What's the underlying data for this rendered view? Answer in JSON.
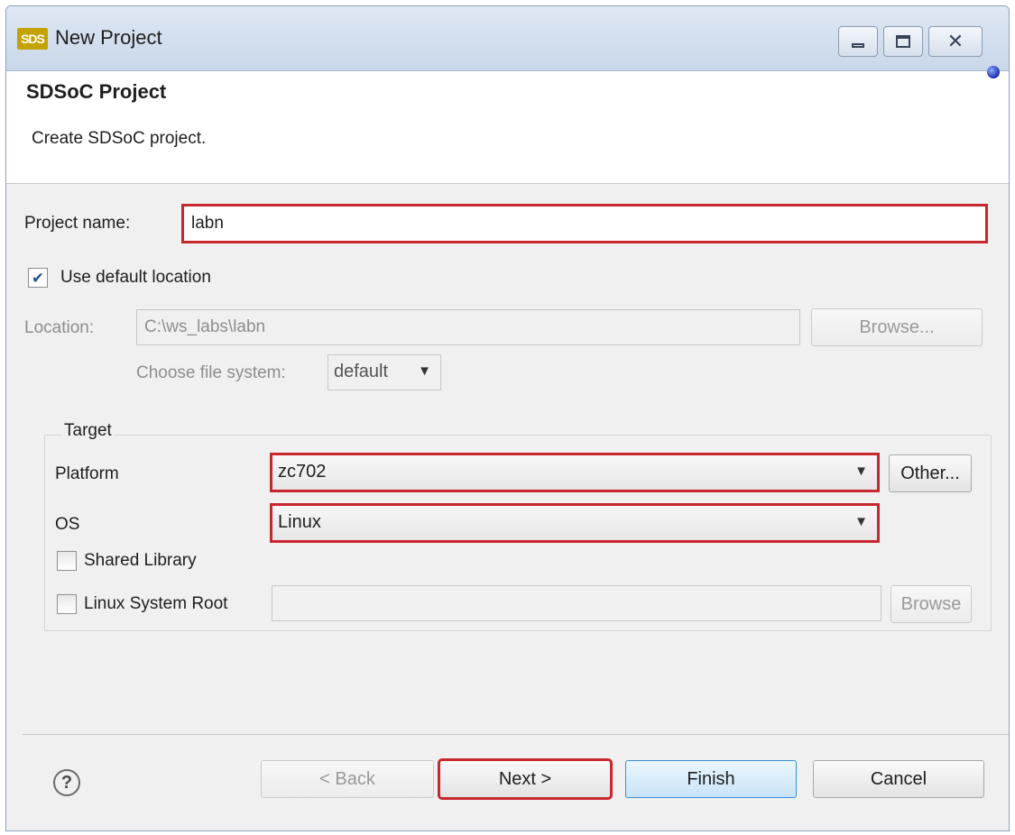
{
  "window": {
    "icon_text": "SDS",
    "title": "New Project"
  },
  "banner": {
    "title": "SDSoC Project",
    "description": "Create SDSoC project."
  },
  "form": {
    "project_name_label": "Project name:",
    "project_name_value": "labn",
    "use_default_location_label": "Use default location",
    "use_default_location_checked": true,
    "location_label": "Location:",
    "location_value": "C:\\ws_labs\\labn",
    "browse_location_label": "Browse...",
    "file_system_label": "Choose file system:",
    "file_system_value": "default"
  },
  "target": {
    "legend": "Target",
    "platform_label": "Platform",
    "platform_value": "zc702",
    "other_label": "Other...",
    "os_label": "OS",
    "os_value": "Linux",
    "shared_library_label": "Shared Library",
    "shared_library_checked": false,
    "linux_system_root_label": "Linux System Root",
    "linux_system_root_checked": false,
    "linux_system_root_value": "",
    "browse_root_label": "Browse"
  },
  "footer": {
    "help_glyph": "?",
    "back_label": "< Back",
    "next_label": "Next >",
    "finish_label": "Finish",
    "cancel_label": "Cancel"
  },
  "colors": {
    "highlight": "#c8282d",
    "default_button_border": "#3c8ed6"
  }
}
